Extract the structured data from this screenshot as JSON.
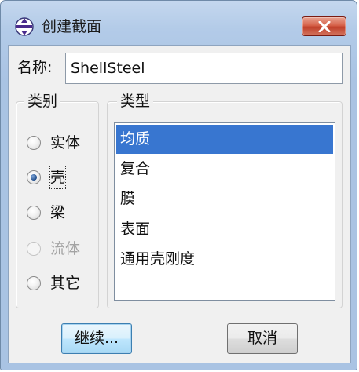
{
  "window": {
    "title": "创建截面",
    "icon": "section-icon",
    "close_icon": "close-icon"
  },
  "name_field": {
    "label": "名称:",
    "value": "ShellSteel"
  },
  "category": {
    "legend": "类别",
    "options": [
      {
        "label": "实体",
        "checked": false,
        "enabled": true
      },
      {
        "label": "壳",
        "checked": true,
        "enabled": true
      },
      {
        "label": "梁",
        "checked": false,
        "enabled": true
      },
      {
        "label": "流体",
        "checked": false,
        "enabled": false
      },
      {
        "label": "其它",
        "checked": false,
        "enabled": true
      }
    ]
  },
  "type": {
    "legend": "类型",
    "items": [
      "均质",
      "复合",
      "膜",
      "表面",
      "通用壳刚度"
    ],
    "selected": "均质"
  },
  "buttons": {
    "continue": "继续...",
    "cancel": "取消"
  },
  "colors": {
    "title_gradient_top": "#c4d7ee",
    "selection": "#3876d0",
    "close_button": "#c0402a",
    "client_background": "#f0f0f0"
  }
}
